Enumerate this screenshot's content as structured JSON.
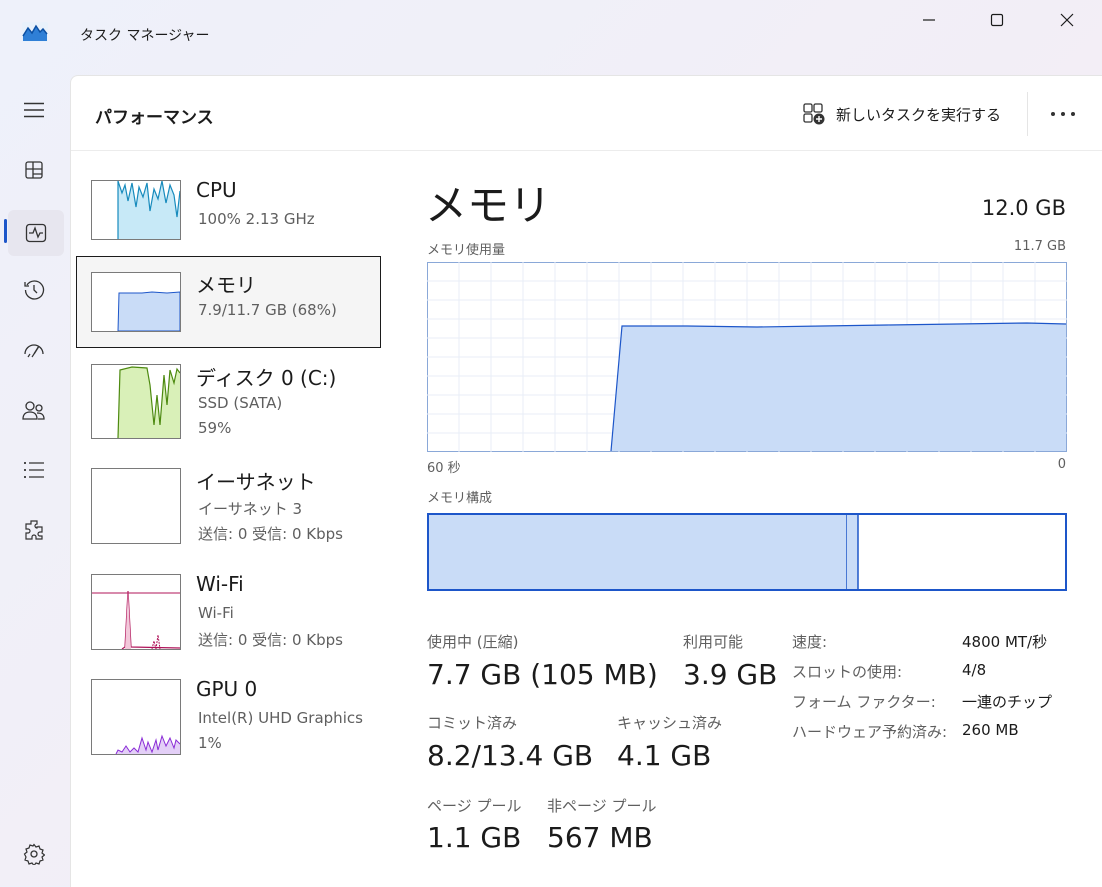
{
  "window": {
    "title": "タスク マネージャー"
  },
  "nav": {
    "items": [
      {
        "icon": "hamburger-menu-icon"
      },
      {
        "icon": "processes-icon"
      },
      {
        "icon": "performance-icon",
        "active": true
      },
      {
        "icon": "app-history-icon"
      },
      {
        "icon": "startup-apps-icon"
      },
      {
        "icon": "users-icon"
      },
      {
        "icon": "details-icon"
      },
      {
        "icon": "services-icon"
      },
      {
        "icon": "settings-icon"
      }
    ]
  },
  "header": {
    "title": "パフォーマンス",
    "new_task_label": "新しいタスクを実行する"
  },
  "resources": [
    {
      "name": "CPU",
      "sub1": "100%  2.13 GHz",
      "sub2": ""
    },
    {
      "name": "メモリ",
      "sub1": "7.9/11.7 GB (68%)",
      "sub2": "",
      "selected": true
    },
    {
      "name": "ディスク 0 (C:)",
      "sub1": "SSD (SATA)",
      "sub2": "59%"
    },
    {
      "name": "イーサネット",
      "sub1": "イーサネット 3",
      "sub2": "送信: 0 受信: 0 Kbps"
    },
    {
      "name": "Wi-Fi",
      "sub1": "Wi-Fi",
      "sub2": "送信: 0 受信: 0 Kbps"
    },
    {
      "name": "GPU 0",
      "sub1": "Intel(R) UHD Graphics",
      "sub2": "1%"
    }
  ],
  "detail": {
    "title": "メモリ",
    "total": "12.0 GB",
    "usage_graph_label": "メモリ使用量",
    "usage_graph_max": "11.7 GB",
    "x_left": "60 秒",
    "x_right": "0",
    "composition_label": "メモリ構成",
    "composition": {
      "in_use": 7.7,
      "modified": 0.2,
      "total": 11.7
    },
    "stats": {
      "in_use_label": "使用中 (圧縮)",
      "in_use_value": "7.7 GB (105 MB)",
      "available_label": "利用可能",
      "available_value": "3.9 GB",
      "committed_label": "コミット済み",
      "committed_value": "8.2/13.4 GB",
      "cached_label": "キャッシュ済み",
      "cached_value": "4.1 GB",
      "paged_label": "ページ プール",
      "paged_value": "1.1 GB",
      "nonpaged_label": "非ページ プール",
      "nonpaged_value": "567 MB"
    },
    "specs": [
      {
        "key": "速度:",
        "value": "4800 MT/秒"
      },
      {
        "key": "スロットの使用:",
        "value": "4/8"
      },
      {
        "key": "フォーム ファクター:",
        "value": "一連のチップ"
      },
      {
        "key": "ハードウェア予約済み:",
        "value": "260 MB"
      }
    ]
  },
  "colors": {
    "memory_fill": "#c9dcf7",
    "memory_line": "#1d56c9",
    "cpu_fill": "#c7e9f7",
    "cpu_line": "#178bbd",
    "disk_fill": "#d9f0b8",
    "disk_line": "#4d8a10",
    "wifi_line": "#b0145a",
    "gpu_line": "#8a2bd6",
    "accent": "#1d56c9"
  }
}
